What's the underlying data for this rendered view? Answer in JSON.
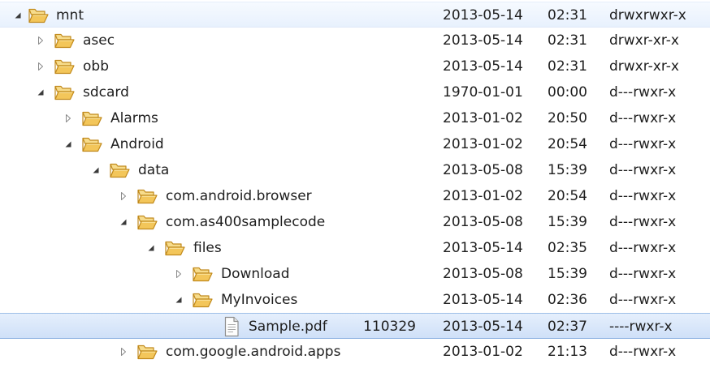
{
  "rows": [
    {
      "name": "mnt",
      "type": "folder",
      "expanded": true,
      "size": "",
      "date": "2013-05-14",
      "time": "02:31",
      "permissions": "drwxrwxr-x"
    },
    {
      "name": "asec",
      "type": "folder",
      "expanded": false,
      "size": "",
      "date": "2013-05-14",
      "time": "02:31",
      "permissions": "drwxr-xr-x"
    },
    {
      "name": "obb",
      "type": "folder",
      "expanded": false,
      "size": "",
      "date": "2013-05-14",
      "time": "02:31",
      "permissions": "drwxr-xr-x"
    },
    {
      "name": "sdcard",
      "type": "folder",
      "expanded": true,
      "size": "",
      "date": "1970-01-01",
      "time": "00:00",
      "permissions": "d---rwxr-x"
    },
    {
      "name": "Alarms",
      "type": "folder",
      "expanded": false,
      "size": "",
      "date": "2013-01-02",
      "time": "20:50",
      "permissions": "d---rwxr-x"
    },
    {
      "name": "Android",
      "type": "folder",
      "expanded": true,
      "size": "",
      "date": "2013-01-02",
      "time": "20:54",
      "permissions": "d---rwxr-x"
    },
    {
      "name": "data",
      "type": "folder",
      "expanded": true,
      "size": "",
      "date": "2013-05-08",
      "time": "15:39",
      "permissions": "d---rwxr-x"
    },
    {
      "name": "com.android.browser",
      "type": "folder",
      "expanded": false,
      "size": "",
      "date": "2013-01-02",
      "time": "20:54",
      "permissions": "d---rwxr-x"
    },
    {
      "name": "com.as400samplecode",
      "type": "folder",
      "expanded": true,
      "size": "",
      "date": "2013-05-08",
      "time": "15:39",
      "permissions": "d---rwxr-x"
    },
    {
      "name": "files",
      "type": "folder",
      "expanded": true,
      "size": "",
      "date": "2013-05-14",
      "time": "02:35",
      "permissions": "d---rwxr-x"
    },
    {
      "name": "Download",
      "type": "folder",
      "expanded": false,
      "size": "",
      "date": "2013-05-08",
      "time": "15:39",
      "permissions": "d---rwxr-x"
    },
    {
      "name": "MyInvoices",
      "type": "folder",
      "expanded": true,
      "size": "",
      "date": "2013-05-14",
      "time": "02:36",
      "permissions": "d---rwxr-x"
    },
    {
      "name": "Sample.pdf",
      "type": "file",
      "expanded": false,
      "size": "110329",
      "date": "2013-05-14",
      "time": "02:37",
      "permissions": "----rwxr-x"
    },
    {
      "name": "com.google.android.apps",
      "type": "folder",
      "expanded": false,
      "size": "",
      "date": "2013-01-02",
      "time": "21:13",
      "permissions": "d---rwxr-x"
    }
  ],
  "selected_row": "Sample.pdf",
  "hovered_row": "mnt",
  "colors": {
    "selection": "#cfe0f8",
    "selection_border": "#8fb3e2",
    "hover": "#e8f1fd",
    "folder_fill": "#f3c65a",
    "folder_stroke": "#c18a1c",
    "text": "#1e1e1e"
  },
  "icons": {
    "folder": "open-folder-icon",
    "file": "document-icon",
    "expanded": "triangle-down-icon",
    "collapsed": "triangle-right-icon"
  }
}
